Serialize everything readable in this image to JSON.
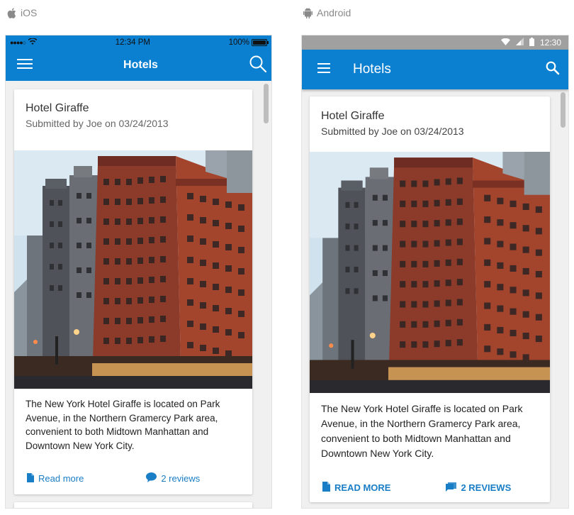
{
  "platforms": {
    "ios_label": "iOS",
    "android_label": "Android"
  },
  "ios": {
    "status": {
      "time": "12:34 PM",
      "battery": "100%"
    },
    "nav": {
      "title": "Hotels",
      "menu_icon": "hamburger-menu-icon",
      "search_icon": "search-icon"
    },
    "card": {
      "title": "Hotel Giraffe",
      "subtitle": "Submitted by Joe on 03/24/2013",
      "image": "hotel-building-photo",
      "description": "The New York Hotel Giraffe is located on Park Avenue, in the Northern Gramercy Park area, convenient to both Midtown Manhattan and Downtown New York City.",
      "read_more": "Read more",
      "reviews": "2 reviews"
    }
  },
  "android": {
    "status": {
      "time": "12:30"
    },
    "nav": {
      "title": "Hotels",
      "menu_icon": "hamburger-menu-icon",
      "search_icon": "search-icon"
    },
    "card": {
      "title": "Hotel Giraffe",
      "subtitle": "Submitted by Joe on 03/24/2013",
      "image": "hotel-building-photo",
      "description": "The New York Hotel Giraffe is located on Park Avenue, in the Northern Gramercy Park area, convenient to both Midtown Manhattan and Downtown New York City.",
      "read_more": "READ MORE",
      "reviews": "2 REVIEWS"
    }
  },
  "colors": {
    "brand_blue": "#0b7fd0",
    "link_blue": "#1a7ec6",
    "android_status_bar": "#a0a0a0"
  }
}
